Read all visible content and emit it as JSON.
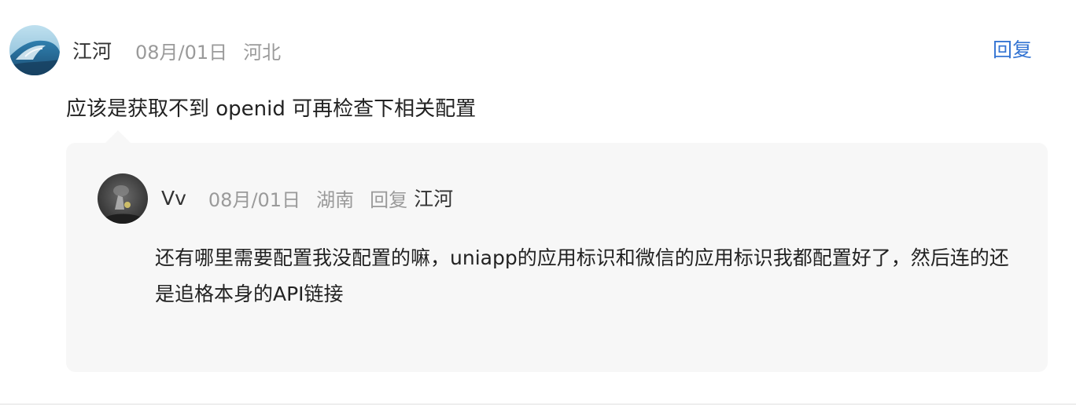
{
  "comment": {
    "author": "江河",
    "date": "08月/01日",
    "location": "河北",
    "reply_label": "回复",
    "body": "应该是获取不到 openid 可再检查下相关配置"
  },
  "reply": {
    "author": "Vv",
    "date": "08月/01日",
    "location": "湖南",
    "reply_to_label": "回复",
    "reply_to_name": "江河",
    "body": "还有哪里需要配置我没配置的嘛，uniapp的应用标识和微信的应用标识我都配置好了，然后连的还是追格本身的API链接"
  },
  "colors": {
    "reply_link": "#3575d3",
    "meta_text": "#9a9a9a",
    "nested_background": "#f7f7f7"
  },
  "icons": {
    "comment_avatar": "ocean-wave-avatar",
    "reply_avatar": "dark-photo-avatar"
  }
}
